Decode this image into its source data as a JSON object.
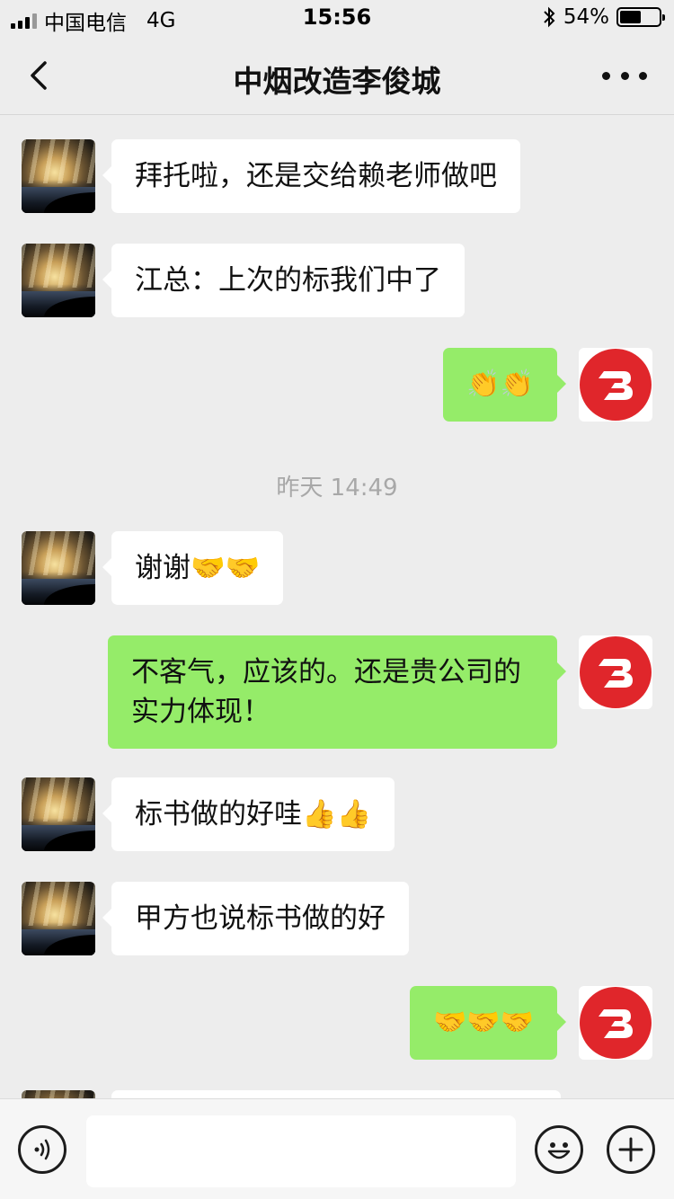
{
  "status_bar": {
    "carrier": "中国电信",
    "network": "4G",
    "time": "15:56",
    "bluetooth_icon": "bluetooth-icon",
    "battery_percent": "54%",
    "battery_level": 0.54
  },
  "nav": {
    "title": "中烟改造李俊城",
    "back_icon": "chevron-left-icon",
    "more_icon": "more-dots-icon"
  },
  "messages": [
    {
      "side": "left",
      "text": "拜托啦，还是交给赖老师做吧"
    },
    {
      "side": "left",
      "text": "江总：上次的标我们中了"
    },
    {
      "side": "right",
      "text": "👏👏"
    },
    {
      "type": "timestamp",
      "text": "昨天 14:49"
    },
    {
      "side": "left",
      "text": "谢谢🤝🤝"
    },
    {
      "side": "right",
      "text": "不客气，应该的。还是贵公司的实力体现！"
    },
    {
      "side": "left",
      "text": "标书做的好哇👍👍"
    },
    {
      "side": "left",
      "text": "甲方也说标书做的好"
    },
    {
      "side": "right",
      "text": "🤝🤝🤝"
    }
  ],
  "input_bar": {
    "voice_icon": "voice-icon",
    "emoji_icon": "emoji-icon",
    "plus_icon": "plus-icon",
    "input_value": ""
  },
  "colors": {
    "background": "#ededed",
    "sent_bubble": "#95ec69",
    "received_bubble": "#ffffff",
    "logo_red": "#e0262b"
  }
}
